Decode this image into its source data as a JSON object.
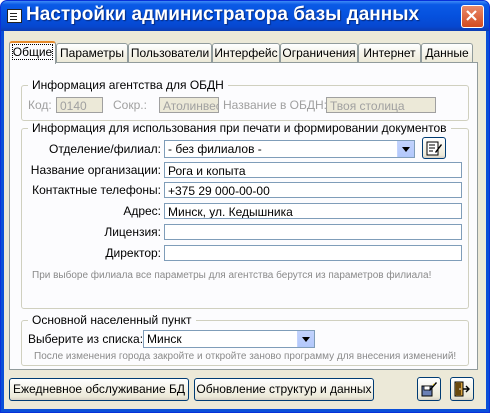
{
  "window": {
    "title": "Настройки администратора базы данных"
  },
  "tabs": [
    {
      "label": "Общие",
      "active": true
    },
    {
      "label": "Параметры"
    },
    {
      "label": "Пользователи"
    },
    {
      "label": "Интерфейс"
    },
    {
      "label": "Ограничения"
    },
    {
      "label": "Интернет"
    },
    {
      "label": "Данные"
    }
  ],
  "agency": {
    "group_label": "Информация агентства для ОБДН",
    "code_label": "Код:",
    "code_value": "0140",
    "short_label": "Сокр.:",
    "short_value": "Атолинвест",
    "name_label": "Название в ОБДН:",
    "name_value": "Твоя столица"
  },
  "print": {
    "group_label": "Информация для использования при печати и формировании документов",
    "branch_label": "Отделение/филиал:",
    "branch_value": "- без филиалов -",
    "org_label": "Название организации:",
    "org_value": "Рога и копыта",
    "phones_label": "Контактные телефоны:",
    "phones_value": "+375 29 000-00-00",
    "address_label": "Адрес:",
    "address_value": "Минск, ул. Кедышника",
    "license_label": "Лицензия:",
    "license_value": "",
    "director_label": "Директор:",
    "director_value": "",
    "note": "При выборе филиала все параметры для агентства берутся из параметров филиала!"
  },
  "city": {
    "group_label": "Основной населенный пункт",
    "select_label": "Выберите из списка:",
    "select_value": "Минск",
    "note": "После изменения города закройте и откройте заново программу для внесения изменений!"
  },
  "footer": {
    "daily_label": "Ежедневное обслуживание БД",
    "update_label": "Обновление структур и данных"
  },
  "colors": {
    "title_bar": "#0551de",
    "close": "#d24a1f",
    "face": "#ece9d8"
  }
}
